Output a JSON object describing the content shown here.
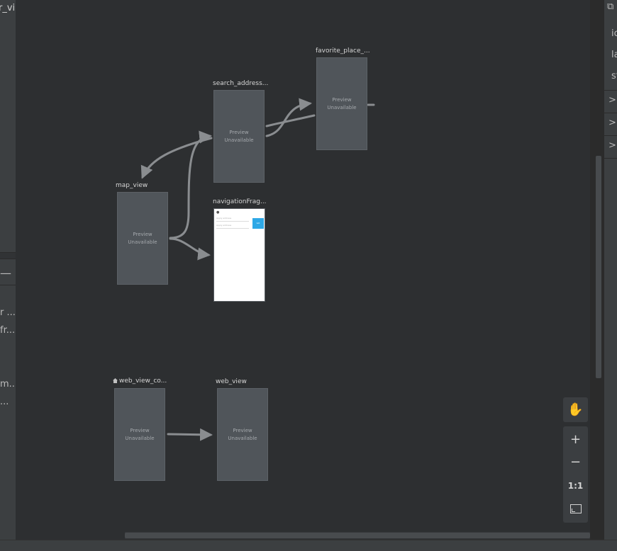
{
  "left_panel": {
    "title": "r_vi",
    "items": [
      "r ...",
      "fr...",
      "m...",
      "..."
    ]
  },
  "right_panel": {
    "attr_rows": [
      "ic",
      "la",
      "st"
    ]
  },
  "canvas": {
    "preview_text_line1": "Preview",
    "preview_text_line2": "Unavailable",
    "destinations": {
      "favorite": {
        "label": "favorite_place_..."
      },
      "search": {
        "label": "search_address..."
      },
      "map": {
        "label": "map_view"
      },
      "navigation": {
        "label": "navigationFrag..."
      },
      "webcontainer": {
        "label": "web_view_co..."
      },
      "webview": {
        "label": "web_view"
      }
    },
    "navigation_preview": {
      "input1": "Apply address",
      "input2": "Apply address",
      "button": "GO"
    }
  },
  "toolbar": {
    "zoom_in": "+",
    "zoom_out": "−",
    "actual_size": "1:1"
  },
  "colors": {
    "canvas_bg": "#2d2f31",
    "panel_bg": "#3c3f41",
    "destination_bg": "#50555a",
    "arrow": "#8a8d90",
    "accent_button": "#2ea8e6"
  }
}
